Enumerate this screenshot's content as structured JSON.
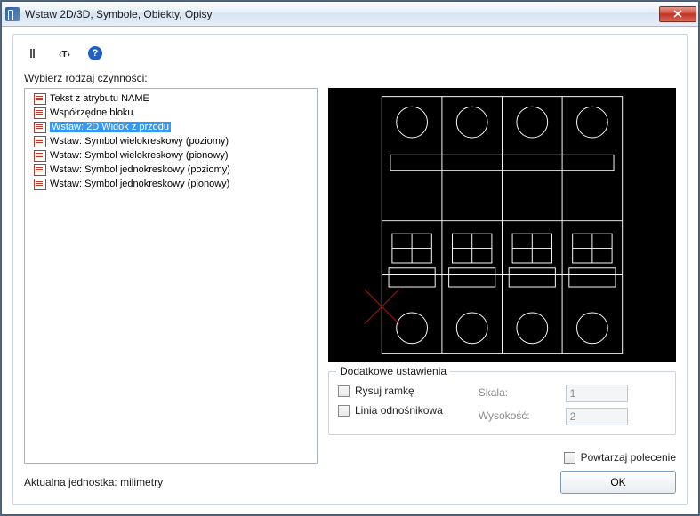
{
  "window": {
    "title": "Wstaw 2D/3D, Symbole, Obiekty, Opisy"
  },
  "labels": {
    "choose_action": "Wybierz rodzaj czynności:",
    "additional_settings": "Dodatkowe ustawienia",
    "draw_frame": "Rysuj ramkę",
    "leader_line": "Linia odnośnikowa",
    "scale": "Skala:",
    "height": "Wysokość:",
    "repeat_command": "Powtarzaj polecenie",
    "unit": "Aktualna jednostka: milimetry",
    "ok": "OK"
  },
  "tree": {
    "items": [
      {
        "label": "Tekst z atrybutu NAME",
        "selected": false
      },
      {
        "label": "Współrzędne bloku",
        "selected": false
      },
      {
        "label": "Wstaw: 2D Widok z przodu",
        "selected": true
      },
      {
        "label": "Wstaw: Symbol wielokreskowy (poziomy)",
        "selected": false
      },
      {
        "label": "Wstaw: Symbol wielokreskowy (pionowy)",
        "selected": false
      },
      {
        "label": "Wstaw: Symbol jednokreskowy (poziomy)",
        "selected": false
      },
      {
        "label": "Wstaw: Symbol jednokreskowy (pionowy)",
        "selected": false
      }
    ]
  },
  "inputs": {
    "scale_value": "1",
    "height_value": "2"
  },
  "icons": {
    "help": "?"
  }
}
